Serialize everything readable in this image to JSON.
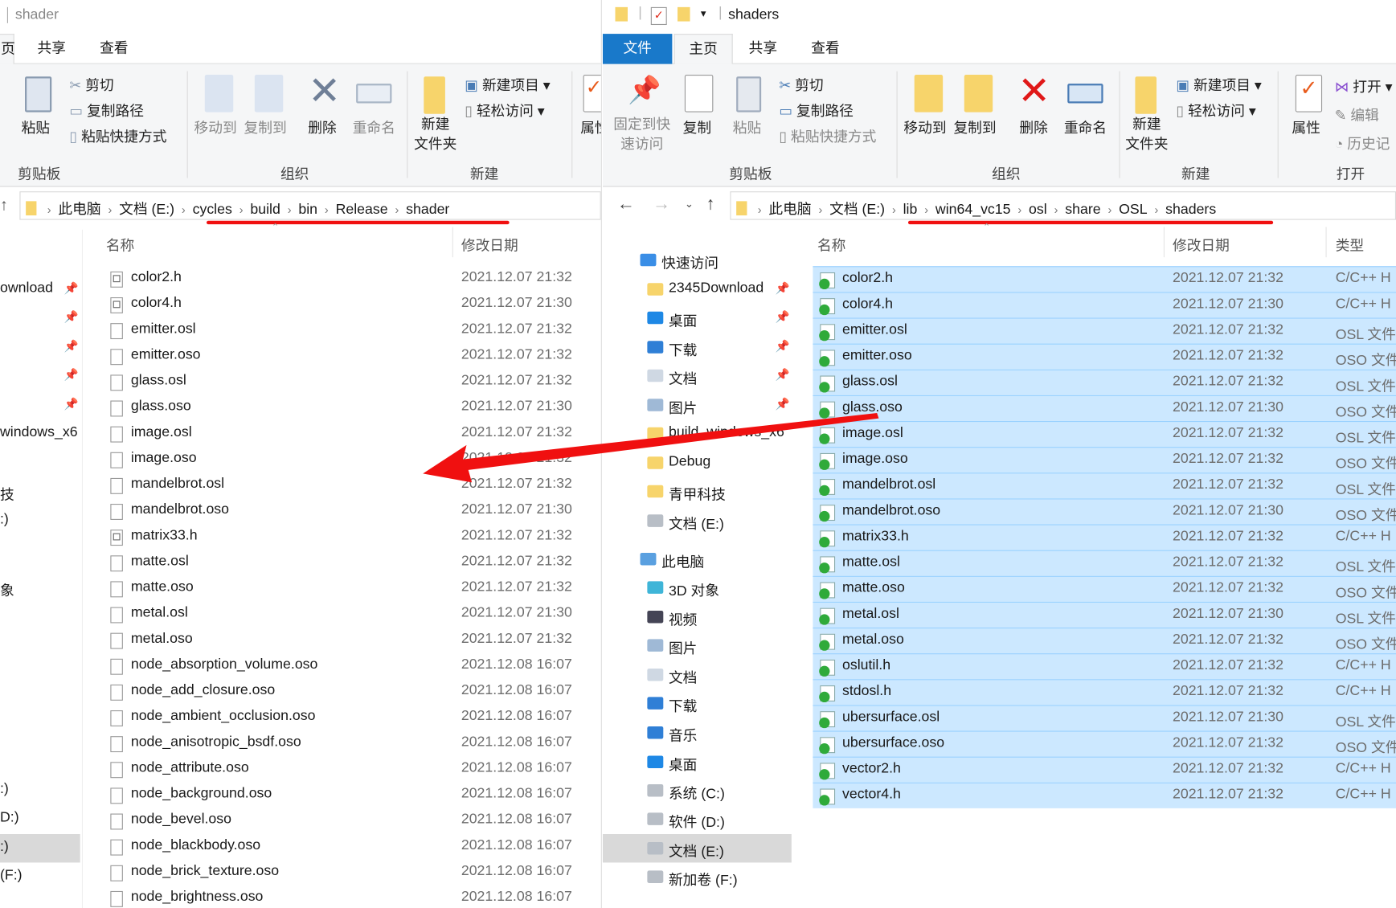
{
  "left_window": {
    "title": "shader",
    "tabs": [
      "页",
      "共享",
      "查看"
    ],
    "ribbon": {
      "cut": "剪切",
      "copy_path": "复制路径",
      "paste": "粘贴",
      "paste_shortcut": "粘贴快捷方式",
      "move_to": "移动到",
      "copy_to": "复制到",
      "delete": "删除",
      "rename": "重命名",
      "new_folder": "新建\n文件夹",
      "new_item": "新建项目",
      "easy_access": "轻松访问",
      "properties": "属性",
      "groups": [
        "剪贴板",
        "组织",
        "新建"
      ]
    },
    "path": [
      "此电脑",
      "文档 (E:)",
      "cycles",
      "build",
      "bin",
      "Release",
      "shader"
    ],
    "columns": {
      "name": "名称",
      "date": "修改日期"
    },
    "nav": [
      {
        "label": "ownload",
        "pin": true
      },
      {
        "label": "",
        "pin": true
      },
      {
        "label": "",
        "pin": true
      },
      {
        "label": "",
        "pin": true
      },
      {
        "label": "",
        "pin": true
      },
      {
        "label": "windows_x6"
      },
      {
        "label": ""
      },
      {
        "label": "技"
      },
      {
        "label": ":)"
      },
      {
        "label": "象"
      },
      {
        "label": ":)"
      },
      {
        "label": "D:)"
      },
      {
        "label": ":)",
        "selected": true
      },
      {
        "label": "(F:)"
      }
    ],
    "files": [
      {
        "name": "color2.h",
        "date": "2021.12.07 21:32",
        "kind": "h"
      },
      {
        "name": "color4.h",
        "date": "2021.12.07 21:30",
        "kind": "h"
      },
      {
        "name": "emitter.osl",
        "date": "2021.12.07 21:32"
      },
      {
        "name": "emitter.oso",
        "date": "2021.12.07 21:32"
      },
      {
        "name": "glass.osl",
        "date": "2021.12.07 21:32"
      },
      {
        "name": "glass.oso",
        "date": "2021.12.07 21:30"
      },
      {
        "name": "image.osl",
        "date": "2021.12.07 21:32"
      },
      {
        "name": "image.oso",
        "date": "2021.12.07 21:32"
      },
      {
        "name": "mandelbrot.osl",
        "date": "2021.12.07 21:32"
      },
      {
        "name": "mandelbrot.oso",
        "date": "2021.12.07 21:30"
      },
      {
        "name": "matrix33.h",
        "date": "2021.12.07 21:32",
        "kind": "h"
      },
      {
        "name": "matte.osl",
        "date": "2021.12.07 21:32"
      },
      {
        "name": "matte.oso",
        "date": "2021.12.07 21:32"
      },
      {
        "name": "metal.osl",
        "date": "2021.12.07 21:30"
      },
      {
        "name": "metal.oso",
        "date": "2021.12.07 21:32"
      },
      {
        "name": "node_absorption_volume.oso",
        "date": "2021.12.08 16:07"
      },
      {
        "name": "node_add_closure.oso",
        "date": "2021.12.08 16:07"
      },
      {
        "name": "node_ambient_occlusion.oso",
        "date": "2021.12.08 16:07"
      },
      {
        "name": "node_anisotropic_bsdf.oso",
        "date": "2021.12.08 16:07"
      },
      {
        "name": "node_attribute.oso",
        "date": "2021.12.08 16:07"
      },
      {
        "name": "node_background.oso",
        "date": "2021.12.08 16:07"
      },
      {
        "name": "node_bevel.oso",
        "date": "2021.12.08 16:07"
      },
      {
        "name": "node_blackbody.oso",
        "date": "2021.12.08 16:07"
      },
      {
        "name": "node_brick_texture.oso",
        "date": "2021.12.08 16:07"
      },
      {
        "name": "node_brightness.oso",
        "date": "2021.12.08 16:07"
      }
    ]
  },
  "right_window": {
    "title": "shaders",
    "tabs": [
      "文件",
      "主页",
      "共享",
      "查看"
    ],
    "ribbon": {
      "pin_quick": "固定到快\n速访问",
      "copy": "复制",
      "paste": "粘贴",
      "cut": "剪切",
      "copy_path": "复制路径",
      "paste_shortcut": "粘贴快捷方式",
      "move_to": "移动到",
      "copy_to": "复制到",
      "delete": "删除",
      "rename": "重命名",
      "new_folder": "新建\n文件夹",
      "new_item": "新建项目",
      "easy_access": "轻松访问",
      "properties": "属性",
      "open": "打开",
      "edit": "编辑",
      "history": "历史记",
      "groups": [
        "剪贴板",
        "组织",
        "新建",
        "打开"
      ]
    },
    "path": [
      "此电脑",
      "文档 (E:)",
      "lib",
      "win64_vc15",
      "osl",
      "share",
      "OSL",
      "shaders"
    ],
    "columns": {
      "name": "名称",
      "date": "修改日期",
      "type": "类型"
    },
    "nav": [
      {
        "label": "快速访问",
        "icon": "star-icon",
        "top": true
      },
      {
        "label": "2345Download",
        "icon": "folder-icon",
        "pin": true
      },
      {
        "label": "桌面",
        "icon": "desktop-icon",
        "pin": true
      },
      {
        "label": "下载",
        "icon": "download-icon",
        "pin": true
      },
      {
        "label": "文档",
        "icon": "document-icon",
        "pin": true
      },
      {
        "label": "图片",
        "icon": "pictures-icon",
        "pin": true
      },
      {
        "label": "build_windows_x6",
        "icon": "folder-icon"
      },
      {
        "label": "Debug",
        "icon": "folder-icon"
      },
      {
        "label": "青甲科技",
        "icon": "folder-icon"
      },
      {
        "label": "文档 (E:)",
        "icon": "drive-icon"
      },
      {
        "label": "此电脑",
        "icon": "computer-icon",
        "top": true,
        "gap": true
      },
      {
        "label": "3D 对象",
        "icon": "3d-objects-icon"
      },
      {
        "label": "视频",
        "icon": "video-icon"
      },
      {
        "label": "图片",
        "icon": "pictures-icon"
      },
      {
        "label": "文档",
        "icon": "document-icon"
      },
      {
        "label": "下载",
        "icon": "download-icon"
      },
      {
        "label": "音乐",
        "icon": "music-icon"
      },
      {
        "label": "桌面",
        "icon": "desktop-icon"
      },
      {
        "label": "系统 (C:)",
        "icon": "drive-icon"
      },
      {
        "label": "软件 (D:)",
        "icon": "drive-icon"
      },
      {
        "label": "文档 (E:)",
        "icon": "drive-icon",
        "selected": true
      },
      {
        "label": "新加卷 (F:)",
        "icon": "drive-icon"
      }
    ],
    "files": [
      {
        "name": "color2.h",
        "date": "2021.12.07 21:32",
        "type": "C/C++ H"
      },
      {
        "name": "color4.h",
        "date": "2021.12.07 21:30",
        "type": "C/C++ H"
      },
      {
        "name": "emitter.osl",
        "date": "2021.12.07 21:32",
        "type": "OSL 文件"
      },
      {
        "name": "emitter.oso",
        "date": "2021.12.07 21:32",
        "type": "OSO 文件"
      },
      {
        "name": "glass.osl",
        "date": "2021.12.07 21:32",
        "type": "OSL 文件"
      },
      {
        "name": "glass.oso",
        "date": "2021.12.07 21:30",
        "type": "OSO 文件"
      },
      {
        "name": "image.osl",
        "date": "2021.12.07 21:32",
        "type": "OSL 文件"
      },
      {
        "name": "image.oso",
        "date": "2021.12.07 21:32",
        "type": "OSO 文件"
      },
      {
        "name": "mandelbrot.osl",
        "date": "2021.12.07 21:32",
        "type": "OSL 文件"
      },
      {
        "name": "mandelbrot.oso",
        "date": "2021.12.07 21:30",
        "type": "OSO 文件"
      },
      {
        "name": "matrix33.h",
        "date": "2021.12.07 21:32",
        "type": "C/C++ H"
      },
      {
        "name": "matte.osl",
        "date": "2021.12.07 21:32",
        "type": "OSL 文件"
      },
      {
        "name": "matte.oso",
        "date": "2021.12.07 21:32",
        "type": "OSO 文件"
      },
      {
        "name": "metal.osl",
        "date": "2021.12.07 21:30",
        "type": "OSL 文件"
      },
      {
        "name": "metal.oso",
        "date": "2021.12.07 21:32",
        "type": "OSO 文件"
      },
      {
        "name": "oslutil.h",
        "date": "2021.12.07 21:32",
        "type": "C/C++ H"
      },
      {
        "name": "stdosl.h",
        "date": "2021.12.07 21:32",
        "type": "C/C++ H"
      },
      {
        "name": "ubersurface.osl",
        "date": "2021.12.07 21:30",
        "type": "OSL 文件"
      },
      {
        "name": "ubersurface.oso",
        "date": "2021.12.07 21:32",
        "type": "OSO 文件"
      },
      {
        "name": "vector2.h",
        "date": "2021.12.07 21:32",
        "type": "C/C++ H"
      },
      {
        "name": "vector4.h",
        "date": "2021.12.07 21:32",
        "type": "C/C++ H"
      }
    ]
  },
  "annotation": {
    "arrow_color": "#f01010",
    "underline_color": "#f01010"
  },
  "colors": {
    "selection": "#cce8ff",
    "file_tab": "#1979ca"
  }
}
